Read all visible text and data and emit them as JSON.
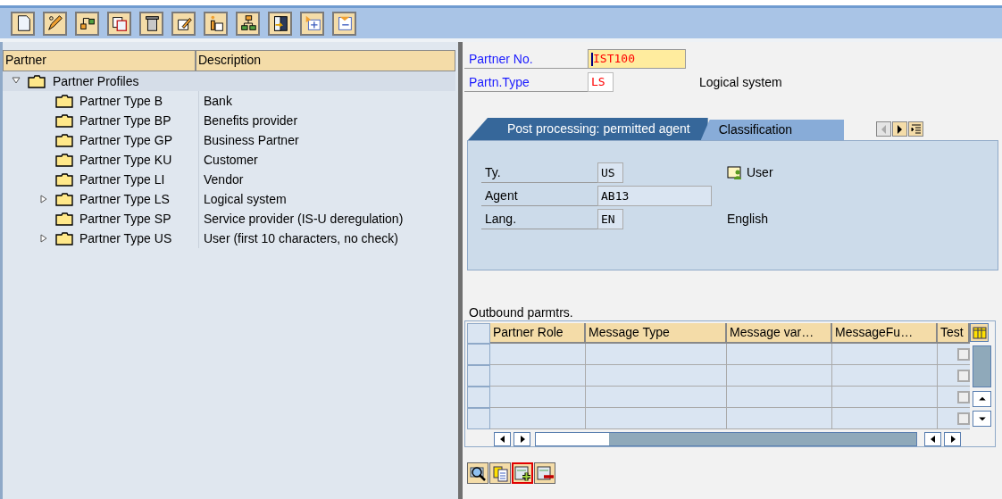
{
  "tree": {
    "columns": [
      "Partner",
      "Description"
    ],
    "root": {
      "label": "Partner Profiles",
      "expanded": true,
      "children": [
        {
          "label": "Partner Type B",
          "description": "Bank",
          "expandable": false
        },
        {
          "label": "Partner Type BP",
          "description": "Benefits provider",
          "expandable": false
        },
        {
          "label": "Partner Type GP",
          "description": "Business Partner",
          "expandable": false
        },
        {
          "label": "Partner Type KU",
          "description": "Customer",
          "expandable": false
        },
        {
          "label": "Partner Type LI",
          "description": "Vendor",
          "expandable": false
        },
        {
          "label": "Partner Type LS",
          "description": "Logical system",
          "expandable": true
        },
        {
          "label": "Partner Type SP",
          "description": "Service provider (IS-U deregulation)",
          "expandable": false
        },
        {
          "label": "Partner Type US",
          "description": "User (first 10 characters, no check)",
          "expandable": true
        }
      ]
    }
  },
  "header_fields": [
    {
      "label": "Partner No.",
      "value": "IST100",
      "focused": true
    },
    {
      "label": "Partn.Type",
      "value": "LS",
      "focused": false,
      "description": "Logical system"
    }
  ],
  "tabs": [
    {
      "label": "Post processing: permitted agent",
      "selected": true
    },
    {
      "label": "Classification",
      "selected": false
    }
  ],
  "tab_fields": [
    {
      "label": "Ty.",
      "value": "US",
      "kind": "short",
      "description": "User",
      "user_icon": true
    },
    {
      "label": "Agent",
      "value": "AB13",
      "kind": "long",
      "user_icon": false
    },
    {
      "label": "Lang.",
      "value": "EN",
      "kind": "short",
      "description": "English",
      "user_icon": false
    }
  ],
  "outbound": {
    "title": "Outbound parmtrs.",
    "columns": [
      "Partner Role",
      "Message Type",
      "Message var…",
      "MessageFu…",
      "Test"
    ],
    "rows": [
      {
        "test": false
      },
      {
        "test": false
      },
      {
        "test": false
      },
      {
        "test": false
      }
    ]
  },
  "bottom_buttons": [
    {
      "selected": false
    },
    {
      "selected": false
    },
    {
      "selected": true
    },
    {
      "selected": false
    }
  ]
}
